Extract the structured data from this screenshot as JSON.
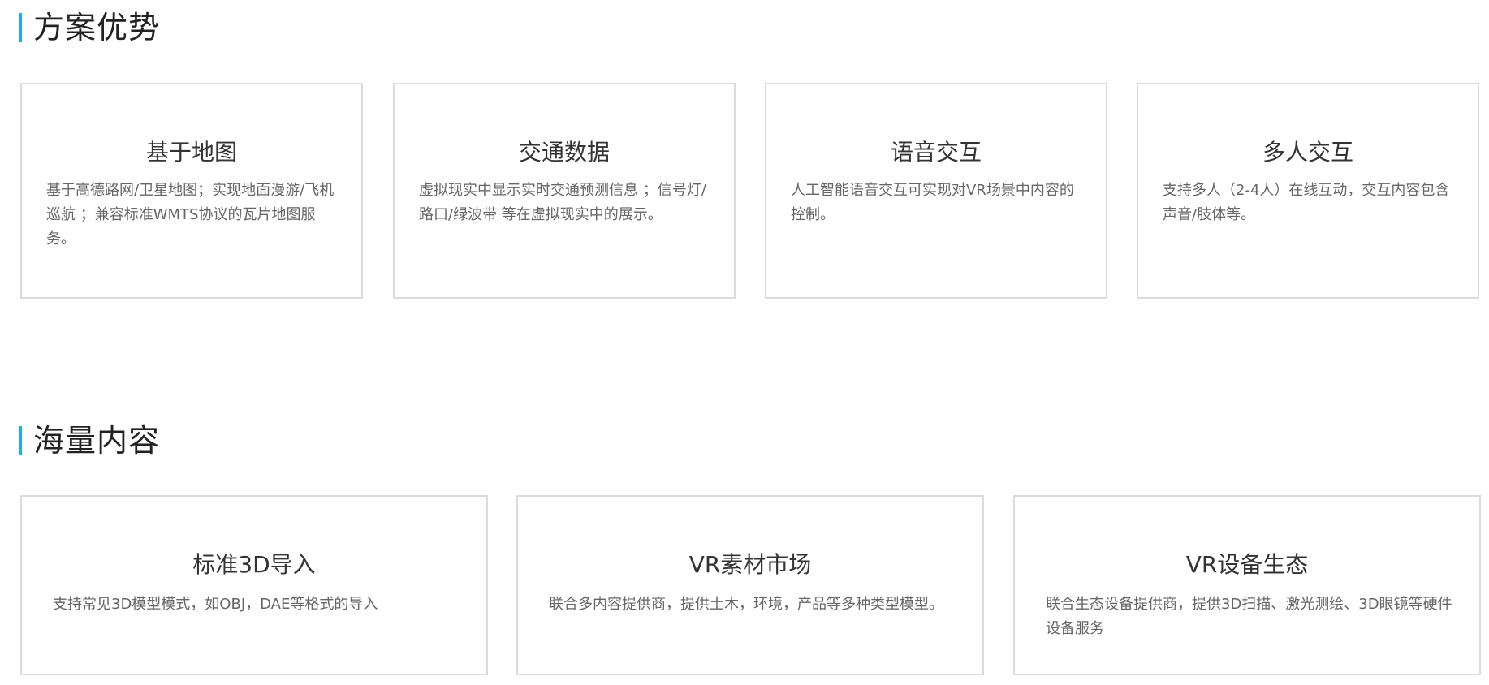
{
  "sections": [
    {
      "title": "方案优势",
      "cards": [
        {
          "title": "基于地图",
          "desc": "基于高德路网/卫星地图；实现地面漫游/飞机巡航 ；兼容标准WMTS协议的瓦片地图服务。"
        },
        {
          "title": "交通数据",
          "desc": "虚拟现实中显示实时交通预测信息 ；信号灯/路口/绿波带 等在虚拟现实中的展示。"
        },
        {
          "title": "语音交互",
          "desc": "人工智能语音交互可实现对VR场景中内容的控制。"
        },
        {
          "title": "多人交互",
          "desc": "支持多人（2-4人）在线互动，交互内容包含声音/肢体等。"
        }
      ]
    },
    {
      "title": "海量内容",
      "cards": [
        {
          "title": "标准3D导入",
          "desc": "支持常见3D模型模式，如OBJ，DAE等格式的导入"
        },
        {
          "title": "VR素材市场",
          "desc": "联合多内容提供商，提供土木，环境，产品等多种类型模型。"
        },
        {
          "title": "VR设备生态",
          "desc": "联合生态设备提供商，提供3D扫描、激光测绘、3D眼镜等硬件设备服务"
        }
      ]
    }
  ],
  "accent_color": "#1ab0e8"
}
